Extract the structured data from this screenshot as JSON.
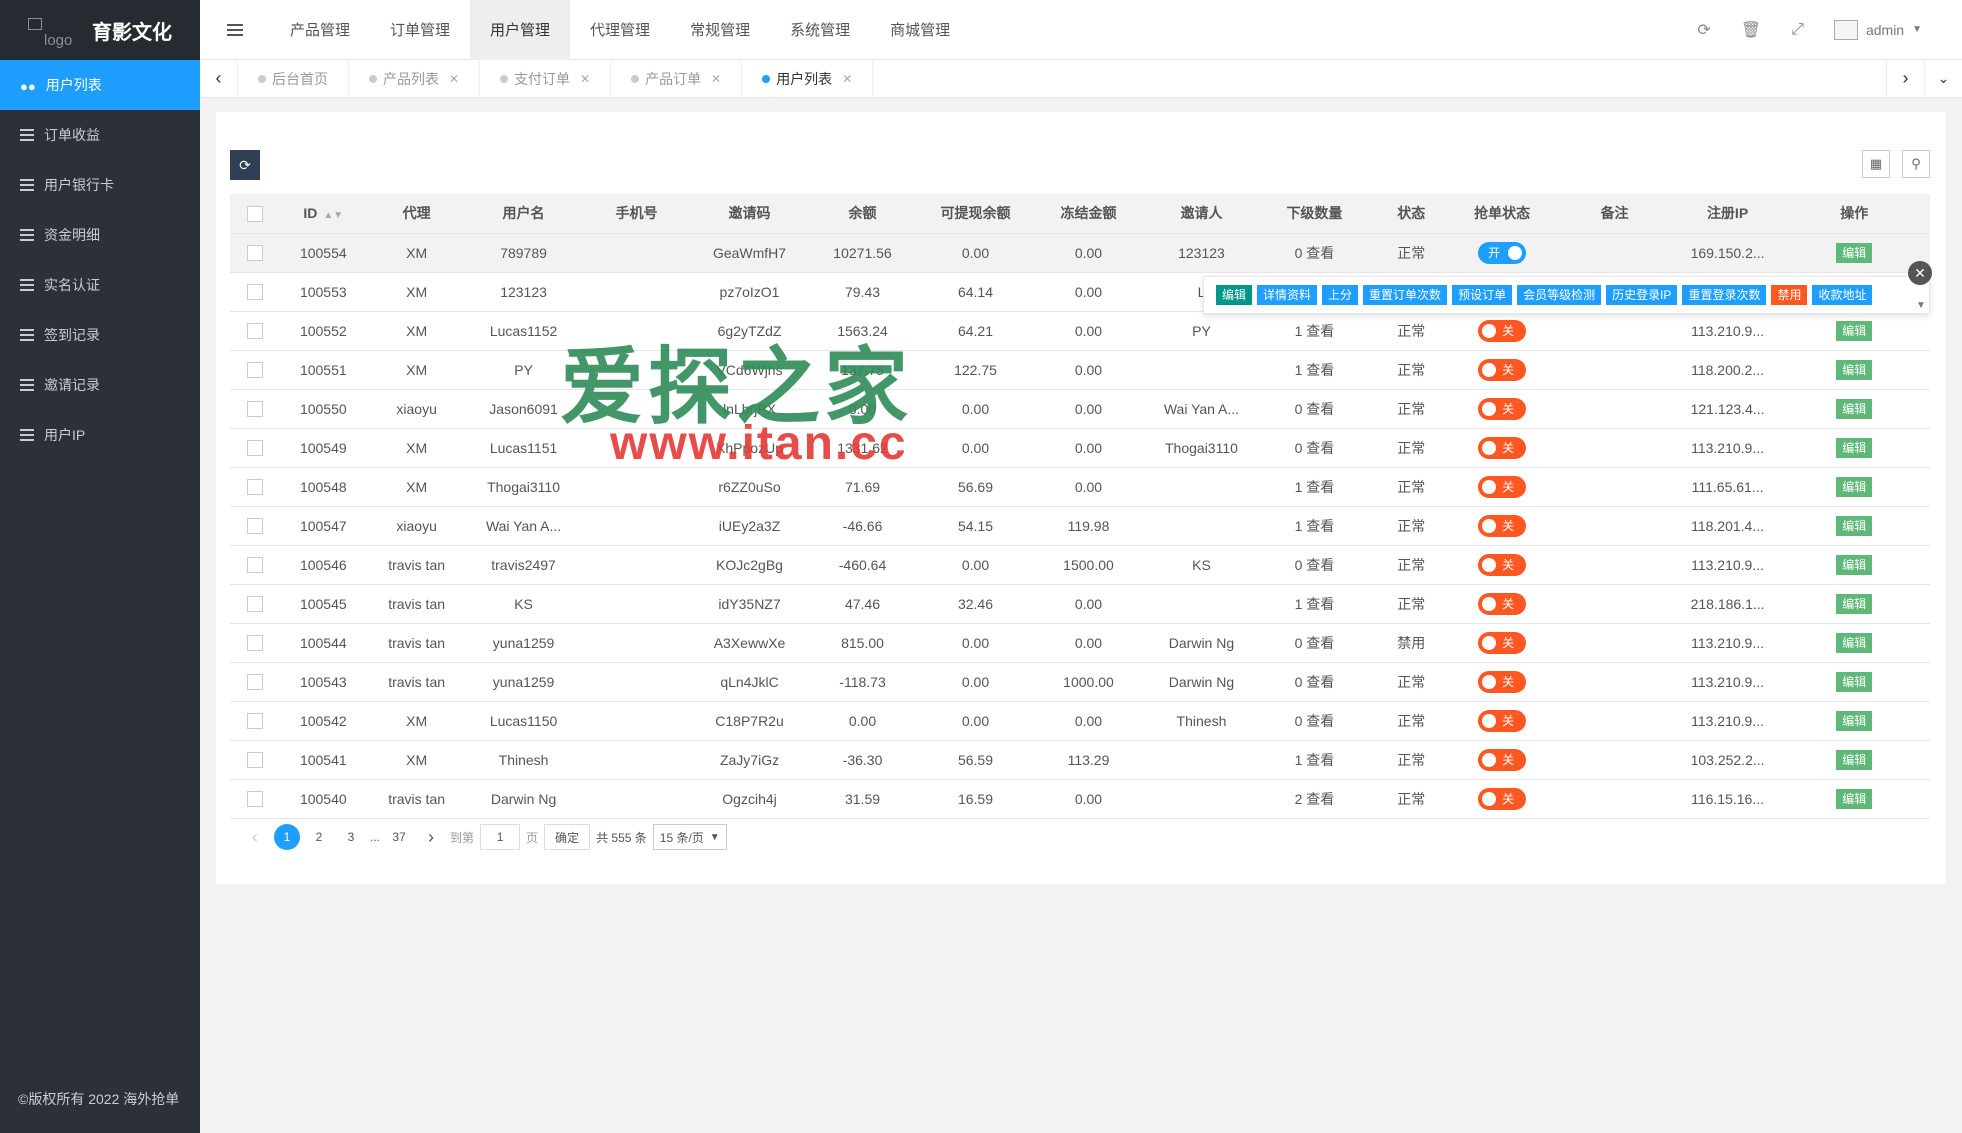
{
  "brand": {
    "logo_alt": "logo",
    "title": "育影文化"
  },
  "sidebar": {
    "items": [
      {
        "label": "用户列表",
        "active": true
      },
      {
        "label": "订单收益"
      },
      {
        "label": "用户银行卡"
      },
      {
        "label": "资金明细"
      },
      {
        "label": "实名认证"
      },
      {
        "label": "签到记录"
      },
      {
        "label": "邀请记录"
      },
      {
        "label": "用户IP"
      }
    ],
    "copyright": "©版权所有 2022 海外抢单"
  },
  "topnav": {
    "items": [
      "产品管理",
      "订单管理",
      "用户管理",
      "代理管理",
      "常规管理",
      "系统管理",
      "商城管理"
    ],
    "active": "用户管理",
    "user": "admin"
  },
  "tabs": {
    "items": [
      "后台首页",
      "产品列表",
      "支付订单",
      "产品订单",
      "用户列表"
    ],
    "active": "用户列表"
  },
  "table": {
    "columns": [
      "ID",
      "代理",
      "用户名",
      "手机号",
      "邀请码",
      "余额",
      "可提现余额",
      "冻结金额",
      "邀请人",
      "下级数量",
      "状态",
      "抢单状态",
      "备注",
      "注册IP",
      "操作"
    ],
    "view_label": "查看",
    "switch_on": "开",
    "switch_off": "关",
    "edit_label": "编辑",
    "rows": [
      {
        "id": "100554",
        "agent": "XM",
        "username": "789789",
        "phone": "",
        "code": "GeaWmfH7",
        "balance": "10271.56",
        "withdrawable": "0.00",
        "frozen": "0.00",
        "inviter": "123123",
        "subs": "0",
        "status": "正常",
        "grab": "on",
        "note": "",
        "ip": "169.150.2..."
      },
      {
        "id": "100553",
        "agent": "XM",
        "username": "123123",
        "phone": "",
        "code": "pz7oIzO1",
        "balance": "79.43",
        "withdrawable": "64.14",
        "frozen": "0.00",
        "inviter": "L",
        "subs": "",
        "status": "",
        "grab": "",
        "note": "",
        "ip": ""
      },
      {
        "id": "100552",
        "agent": "XM",
        "username": "Lucas1152",
        "phone": "",
        "code": "6g2yTZdZ",
        "balance": "1563.24",
        "withdrawable": "64.21",
        "frozen": "0.00",
        "inviter": "PY",
        "subs": "1",
        "status": "正常",
        "grab": "off",
        "note": "",
        "ip": "113.210.9..."
      },
      {
        "id": "100551",
        "agent": "XM",
        "username": "PY",
        "phone": "",
        "code": "VCd6Wjhs",
        "balance": "137.75",
        "withdrawable": "122.75",
        "frozen": "0.00",
        "inviter": "",
        "subs": "1",
        "status": "正常",
        "grab": "off",
        "note": "",
        "ip": "118.200.2..."
      },
      {
        "id": "100550",
        "agent": "xiaoyu",
        "username": "Jason6091",
        "phone": "",
        "code": "lnLbrjPX",
        "balance": "0.00",
        "withdrawable": "0.00",
        "frozen": "0.00",
        "inviter": "Wai Yan A...",
        "subs": "0",
        "status": "正常",
        "grab": "off",
        "note": "",
        "ip": "121.123.4..."
      },
      {
        "id": "100549",
        "agent": "XM",
        "username": "Lucas1151",
        "phone": "",
        "code": "XhPpozUp",
        "balance": "1331.62",
        "withdrawable": "0.00",
        "frozen": "0.00",
        "inviter": "Thogai3110",
        "subs": "0",
        "status": "正常",
        "grab": "off",
        "note": "",
        "ip": "113.210.9..."
      },
      {
        "id": "100548",
        "agent": "XM",
        "username": "Thogai3110",
        "phone": "",
        "code": "r6ZZ0uSo",
        "balance": "71.69",
        "withdrawable": "56.69",
        "frozen": "0.00",
        "inviter": "",
        "subs": "1",
        "status": "正常",
        "grab": "off",
        "note": "",
        "ip": "111.65.61..."
      },
      {
        "id": "100547",
        "agent": "xiaoyu",
        "username": "Wai Yan A...",
        "phone": "",
        "code": "iUEy2a3Z",
        "balance": "-46.66",
        "withdrawable": "54.15",
        "frozen": "119.98",
        "inviter": "",
        "subs": "1",
        "status": "正常",
        "grab": "off",
        "note": "",
        "ip": "118.201.4..."
      },
      {
        "id": "100546",
        "agent": "travis tan",
        "username": "travis2497",
        "phone": "",
        "code": "KOJc2gBg",
        "balance": "-460.64",
        "withdrawable": "0.00",
        "frozen": "1500.00",
        "inviter": "KS",
        "subs": "0",
        "status": "正常",
        "grab": "off",
        "note": "",
        "ip": "113.210.9..."
      },
      {
        "id": "100545",
        "agent": "travis tan",
        "username": "KS",
        "phone": "",
        "code": "idY35NZ7",
        "balance": "47.46",
        "withdrawable": "32.46",
        "frozen": "0.00",
        "inviter": "",
        "subs": "1",
        "status": "正常",
        "grab": "off",
        "note": "",
        "ip": "218.186.1..."
      },
      {
        "id": "100544",
        "agent": "travis tan",
        "username": "yuna1259",
        "phone": "",
        "code": "A3XewwXe",
        "balance": "815.00",
        "withdrawable": "0.00",
        "frozen": "0.00",
        "inviter": "Darwin Ng",
        "subs": "0",
        "status": "禁用",
        "grab": "off",
        "note": "",
        "ip": "113.210.9..."
      },
      {
        "id": "100543",
        "agent": "travis tan",
        "username": "yuna1259",
        "phone": "",
        "code": "qLn4JklC",
        "balance": "-118.73",
        "withdrawable": "0.00",
        "frozen": "1000.00",
        "inviter": "Darwin Ng",
        "subs": "0",
        "status": "正常",
        "grab": "off",
        "note": "",
        "ip": "113.210.9..."
      },
      {
        "id": "100542",
        "agent": "XM",
        "username": "Lucas1150",
        "phone": "",
        "code": "C18P7R2u",
        "balance": "0.00",
        "withdrawable": "0.00",
        "frozen": "0.00",
        "inviter": "Thinesh",
        "subs": "0",
        "status": "正常",
        "grab": "off",
        "note": "",
        "ip": "113.210.9..."
      },
      {
        "id": "100541",
        "agent": "XM",
        "username": "Thinesh",
        "phone": "",
        "code": "ZaJy7iGz",
        "balance": "-36.30",
        "withdrawable": "56.59",
        "frozen": "113.29",
        "inviter": "",
        "subs": "1",
        "status": "正常",
        "grab": "off",
        "note": "",
        "ip": "103.252.2..."
      },
      {
        "id": "100540",
        "agent": "travis tan",
        "username": "Darwin Ng",
        "phone": "",
        "code": "Ogzcih4j",
        "balance": "31.59",
        "withdrawable": "16.59",
        "frozen": "0.00",
        "inviter": "",
        "subs": "2",
        "status": "正常",
        "grab": "off",
        "note": "",
        "ip": "116.15.16..."
      }
    ]
  },
  "popup": {
    "buttons": [
      {
        "label": "编辑",
        "style": "teal"
      },
      {
        "label": "详情资料",
        "style": "blue"
      },
      {
        "label": "上分",
        "style": "blue"
      },
      {
        "label": "重置订单次数",
        "style": "blue"
      },
      {
        "label": "预设订单",
        "style": "blue"
      },
      {
        "label": "会员等级检测",
        "style": "blue"
      },
      {
        "label": "历史登录IP",
        "style": "blue"
      },
      {
        "label": "重置登录次数",
        "style": "blue"
      },
      {
        "label": "禁用",
        "style": "red"
      },
      {
        "label": "收款地址",
        "style": "blue"
      }
    ]
  },
  "pagination": {
    "pages": [
      "1",
      "2",
      "3",
      "...",
      "37"
    ],
    "current": "1",
    "goto_label": "到第",
    "goto_value": "1",
    "page_unit": "页",
    "confirm": "确定",
    "total": "共 555 条",
    "page_size": "15 条/页"
  },
  "watermark": {
    "text": "爱探之家",
    "url": "www.itan.cc"
  },
  "colors": {
    "primary": "#1e9fff",
    "sidebar": "#2c3138",
    "danger": "#ff5722",
    "success": "#5fb878",
    "teal": "#009688"
  }
}
